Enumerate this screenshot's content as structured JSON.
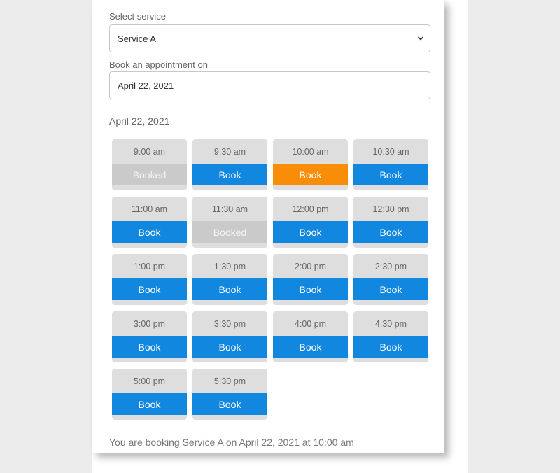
{
  "form": {
    "service_label": "Select service",
    "service_value": "Service A",
    "date_label": "Book an appointment on",
    "date_value": "April 22, 2021"
  },
  "selected_date_heading": "April 22, 2021",
  "colors": {
    "book": "#1187e0",
    "selected": "#fa8d07",
    "booked": "#cacaca"
  },
  "slots": [
    {
      "time": "9:00 am",
      "label": "Booked",
      "state": "booked"
    },
    {
      "time": "9:30 am",
      "label": "Book",
      "state": "available"
    },
    {
      "time": "10:00 am",
      "label": "Book",
      "state": "selected"
    },
    {
      "time": "10:30 am",
      "label": "Book",
      "state": "available"
    },
    {
      "time": "11:00 am",
      "label": "Book",
      "state": "available"
    },
    {
      "time": "11:30 am",
      "label": "Booked",
      "state": "booked"
    },
    {
      "time": "12:00 pm",
      "label": "Book",
      "state": "available"
    },
    {
      "time": "12:30 pm",
      "label": "Book",
      "state": "available"
    },
    {
      "time": "1:00 pm",
      "label": "Book",
      "state": "available"
    },
    {
      "time": "1:30 pm",
      "label": "Book",
      "state": "available"
    },
    {
      "time": "2:00 pm",
      "label": "Book",
      "state": "available"
    },
    {
      "time": "2:30 pm",
      "label": "Book",
      "state": "available"
    },
    {
      "time": "3:00 pm",
      "label": "Book",
      "state": "available"
    },
    {
      "time": "3:30 pm",
      "label": "Book",
      "state": "available"
    },
    {
      "time": "4:00 pm",
      "label": "Book",
      "state": "available"
    },
    {
      "time": "4:30 pm",
      "label": "Book",
      "state": "available"
    },
    {
      "time": "5:00 pm",
      "label": "Book",
      "state": "available"
    },
    {
      "time": "5:30 pm",
      "label": "Book",
      "state": "available"
    }
  ],
  "summary": "You are booking Service A on April 22, 2021 at 10:00 am"
}
